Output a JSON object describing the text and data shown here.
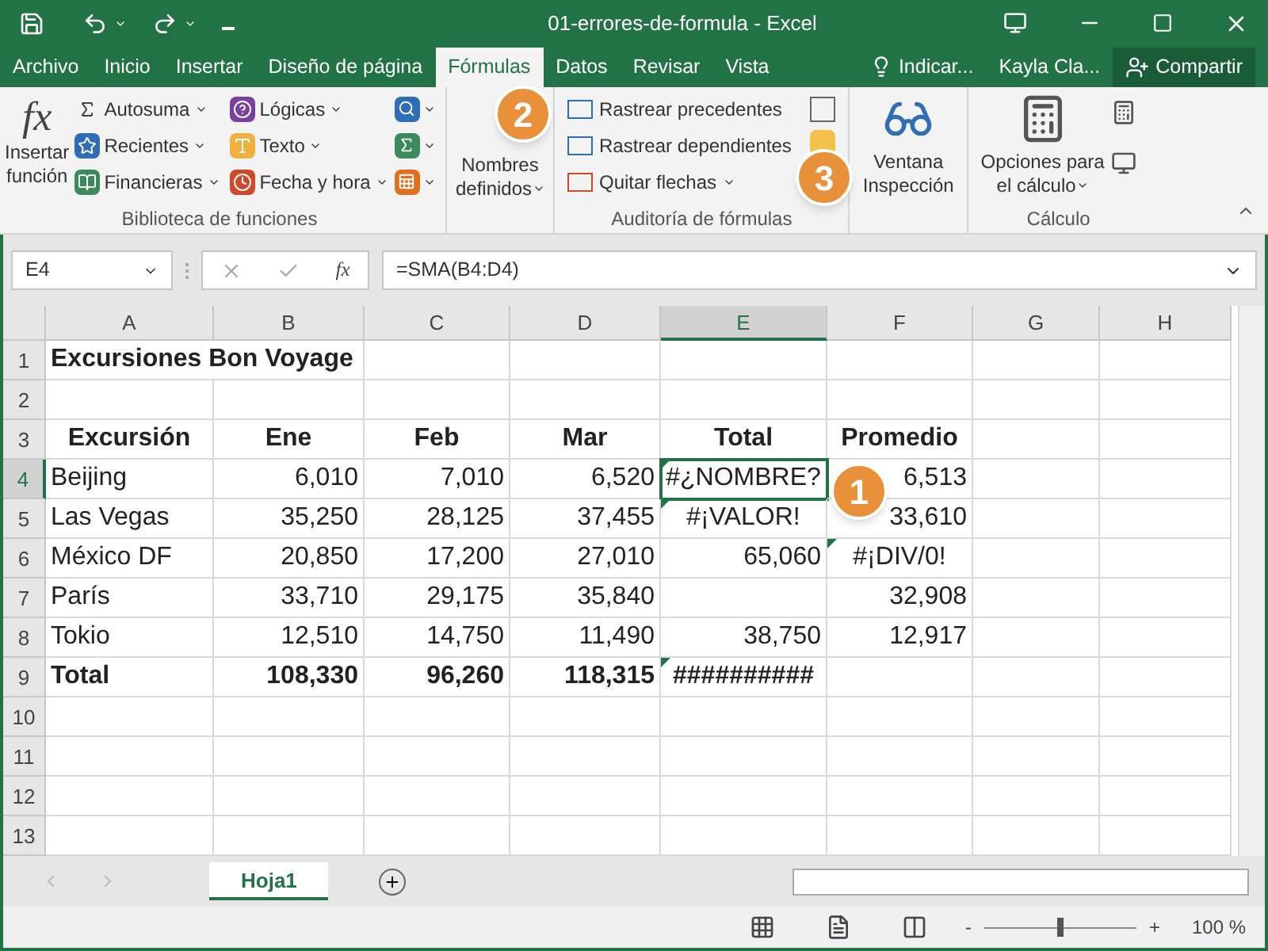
{
  "title_bar": {
    "title": "01-errores-de-formula  -  Excel"
  },
  "tabs": [
    {
      "label": "Archivo",
      "selected": false
    },
    {
      "label": "Inicio",
      "selected": false
    },
    {
      "label": "Insertar",
      "selected": false
    },
    {
      "label": "Diseño de página",
      "selected": false
    },
    {
      "label": "Fórmulas",
      "selected": true
    },
    {
      "label": "Datos",
      "selected": false
    },
    {
      "label": "Revisar",
      "selected": false
    },
    {
      "label": "Vista",
      "selected": false
    }
  ],
  "tell_me": "Indicar...",
  "user": "Kayla Cla...",
  "share": "Compartir",
  "ribbon": {
    "fx": "fx",
    "insert_function": [
      "Insertar",
      "función"
    ],
    "library": [
      "Autosuma",
      "Recientes",
      "Financieras",
      "Lógicas",
      "Texto",
      "Fecha y hora"
    ],
    "library_title": "Biblioteca de funciones",
    "defined_names": [
      "Nombres",
      "definidos"
    ],
    "audit": [
      "Rastrear precedentes",
      "Rastrear dependientes",
      "Quitar flechas"
    ],
    "audit_title": "Auditoría de fórmulas",
    "watch": [
      "Ventana",
      "Inspección"
    ],
    "calc_options": [
      "Opciones para",
      "el cálculo"
    ],
    "calc_title": "Cálculo"
  },
  "formula_bar": {
    "name_box": "E4",
    "fx": "fx",
    "formula": "=SMA(B4:D4)"
  },
  "columns": [
    {
      "label": "A",
      "selected": false
    },
    {
      "label": "B",
      "selected": false
    },
    {
      "label": "C",
      "selected": false
    },
    {
      "label": "D",
      "selected": false
    },
    {
      "label": "E",
      "selected": true
    },
    {
      "label": "F",
      "selected": false
    },
    {
      "label": "G",
      "selected": false
    },
    {
      "label": "H",
      "selected": false
    }
  ],
  "rows": [
    {
      "number": "1",
      "selected": false,
      "bold": true,
      "cells": {
        "A": {
          "text": "Excursiones Bon Voyage",
          "kind": "label",
          "flag": false
        }
      }
    },
    {
      "number": "2",
      "selected": false,
      "cells": {}
    },
    {
      "number": "3",
      "selected": false,
      "bold": true,
      "cells": {
        "A": {
          "text": "Excursión",
          "kind": "heading",
          "flag": false
        },
        "B": {
          "text": "Ene",
          "kind": "heading",
          "flag": false
        },
        "C": {
          "text": "Feb",
          "kind": "heading",
          "flag": false
        },
        "D": {
          "text": "Mar",
          "kind": "heading",
          "flag": false
        },
        "E": {
          "text": "Total",
          "kind": "heading",
          "flag": false
        },
        "F": {
          "text": "Promedio",
          "kind": "heading",
          "flag": false
        }
      }
    },
    {
      "number": "4",
      "selected": true,
      "bold": false,
      "cells": {
        "A": {
          "text": "Beijing",
          "kind": "label",
          "flag": false
        },
        "B": {
          "text": "6,010",
          "kind": "number",
          "flag": false
        },
        "C": {
          "text": "7,010",
          "kind": "number",
          "flag": false
        },
        "D": {
          "text": "6,520",
          "kind": "number",
          "flag": false
        },
        "E": {
          "text": "#¿NOMBRE?",
          "kind": "error",
          "flag": true
        },
        "F": {
          "text": "6,513",
          "kind": "number",
          "flag": false
        }
      }
    },
    {
      "number": "5",
      "selected": false,
      "bold": false,
      "cells": {
        "A": {
          "text": "Las Vegas",
          "kind": "label",
          "flag": false
        },
        "B": {
          "text": "35,250",
          "kind": "number",
          "flag": false
        },
        "C": {
          "text": "28,125",
          "kind": "number",
          "flag": false
        },
        "D": {
          "text": "37,455",
          "kind": "number",
          "flag": false
        },
        "E": {
          "text": "#¡VALOR!",
          "kind": "error",
          "flag": true
        },
        "F": {
          "text": "33,610",
          "kind": "number",
          "flag": false
        }
      }
    },
    {
      "number": "6",
      "selected": false,
      "bold": false,
      "cells": {
        "A": {
          "text": "México DF",
          "kind": "label",
          "flag": false
        },
        "B": {
          "text": "20,850",
          "kind": "number",
          "flag": false
        },
        "C": {
          "text": "17,200",
          "kind": "number",
          "flag": false
        },
        "D": {
          "text": "27,010",
          "kind": "number",
          "flag": false
        },
        "E": {
          "text": "65,060",
          "kind": "number",
          "flag": false
        },
        "F": {
          "text": "#¡DIV/0!",
          "kind": "error",
          "flag": true
        }
      }
    },
    {
      "number": "7",
      "selected": false,
      "bold": false,
      "cells": {
        "A": {
          "text": "París",
          "kind": "label",
          "flag": false
        },
        "B": {
          "text": "33,710",
          "kind": "number",
          "flag": false
        },
        "C": {
          "text": "29,175",
          "kind": "number",
          "flag": false
        },
        "D": {
          "text": "35,840",
          "kind": "number",
          "flag": false
        },
        "F": {
          "text": "32,908",
          "kind": "number",
          "flag": false
        }
      }
    },
    {
      "number": "8",
      "selected": false,
      "bold": false,
      "cells": {
        "A": {
          "text": "Tokio",
          "kind": "label",
          "flag": false
        },
        "B": {
          "text": "12,510",
          "kind": "number",
          "flag": false
        },
        "C": {
          "text": "14,750",
          "kind": "number",
          "flag": false
        },
        "D": {
          "text": "11,490",
          "kind": "number",
          "flag": false
        },
        "E": {
          "text": "38,750",
          "kind": "number",
          "flag": false
        },
        "F": {
          "text": "12,917",
          "kind": "number",
          "flag": false
        }
      }
    },
    {
      "number": "9",
      "selected": false,
      "bold": true,
      "cells": {
        "A": {
          "text": "Total",
          "kind": "label",
          "flag": false
        },
        "B": {
          "text": "108,330",
          "kind": "number",
          "flag": false
        },
        "C": {
          "text": "96,260",
          "kind": "number",
          "flag": false
        },
        "D": {
          "text": "118,315",
          "kind": "number",
          "flag": false
        },
        "E": {
          "text": "##########",
          "kind": "error",
          "flag": true
        }
      }
    },
    {
      "number": "10",
      "selected": false,
      "cells": {}
    },
    {
      "number": "11",
      "selected": false,
      "cells": {}
    },
    {
      "number": "12",
      "selected": false,
      "cells": {}
    },
    {
      "number": "13",
      "selected": false,
      "cells": {}
    }
  ],
  "sheets": [
    {
      "label": "Hoja1",
      "selected": true
    }
  ],
  "status_bar": {
    "zoom": "100 %",
    "zoom_minus": "-",
    "zoom_plus": "+",
    "level": 0.5
  },
  "callouts": [
    {
      "number": "2"
    },
    {
      "number": "3"
    },
    {
      "number": "1"
    }
  ]
}
